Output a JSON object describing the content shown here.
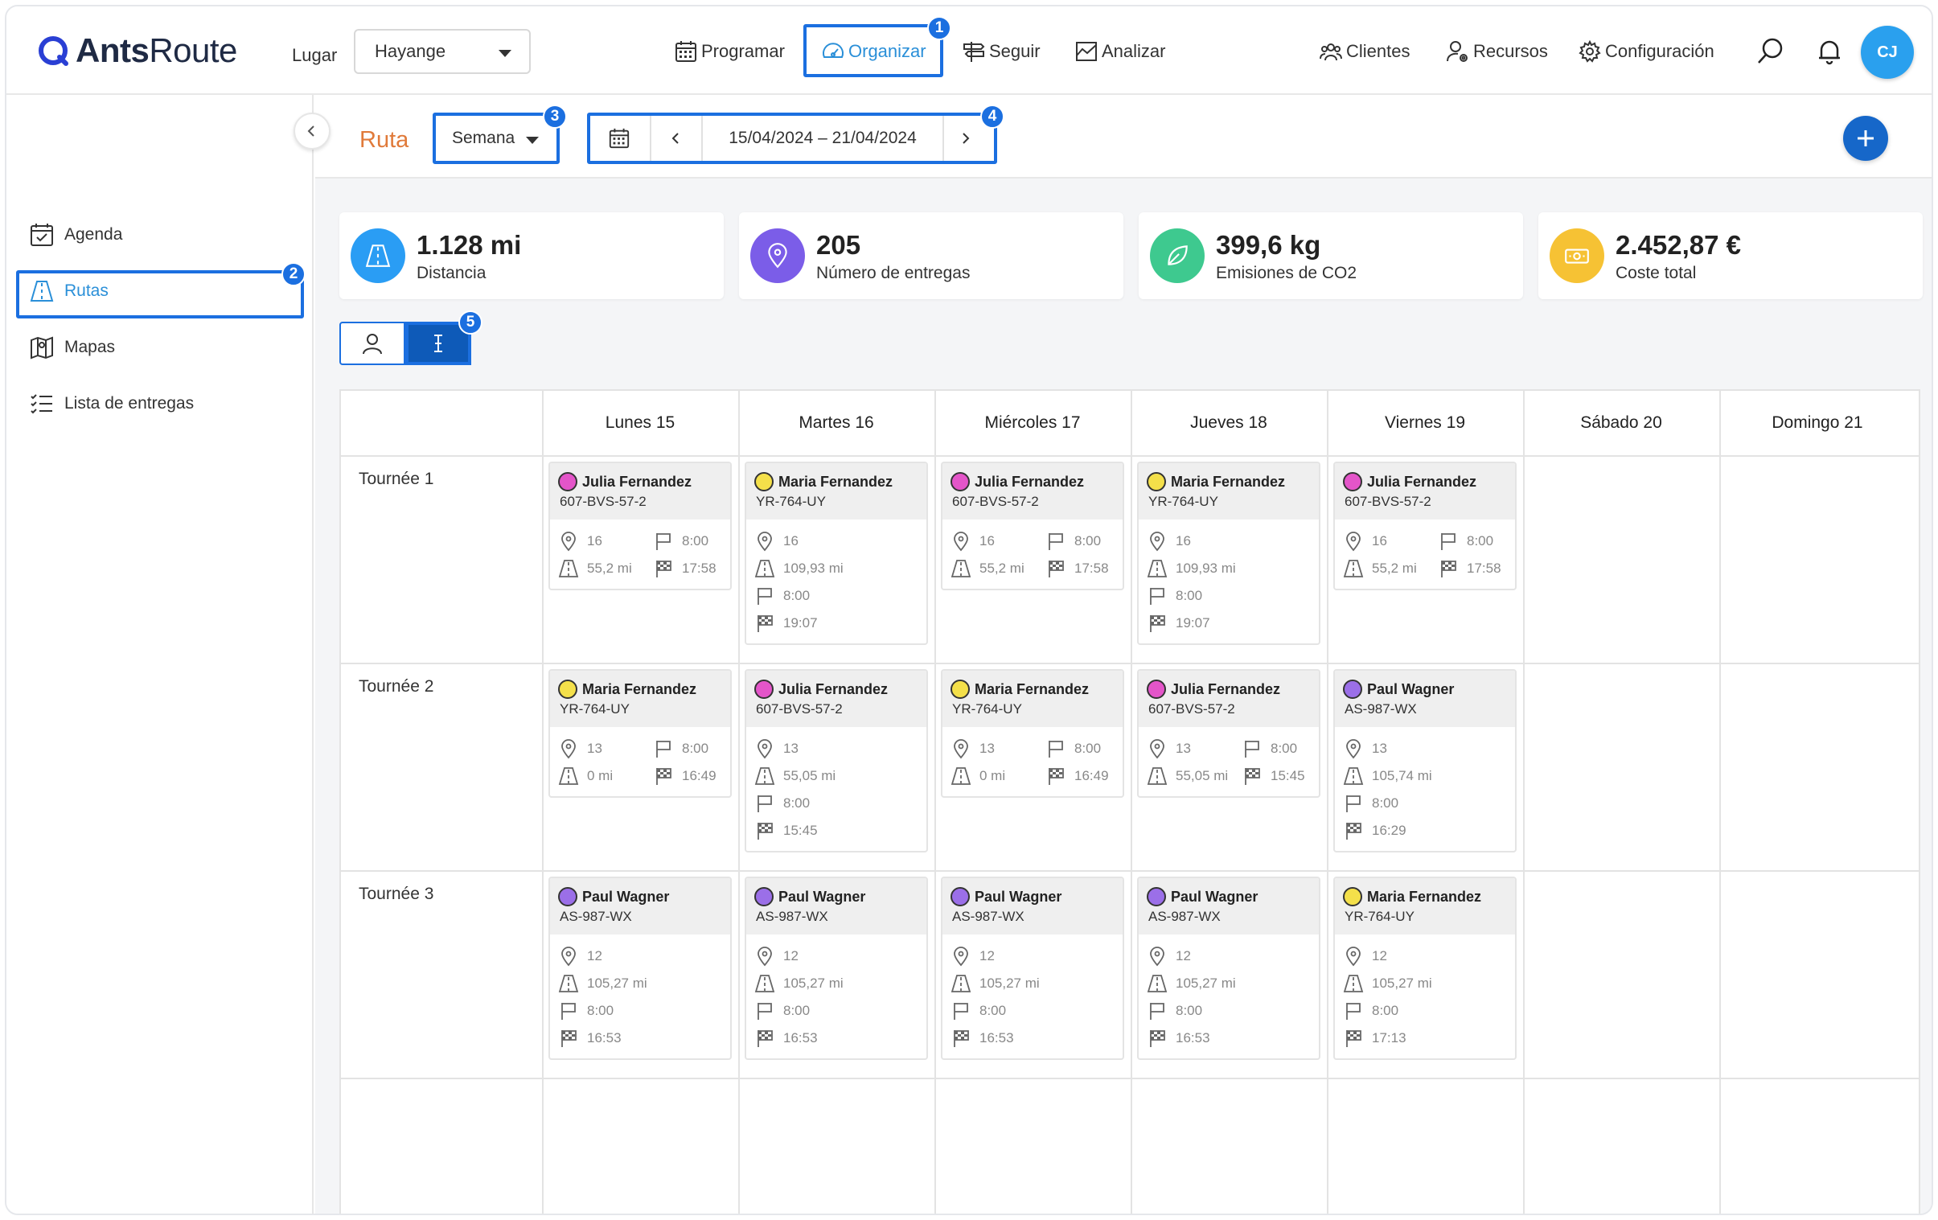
{
  "app": {
    "brand_bold": "Ants",
    "brand_light": "Route",
    "avatar_initials": "CJ"
  },
  "header": {
    "lugar_label": "Lugar",
    "lugar_value": "Hayange",
    "nav": [
      {
        "label": "Programar",
        "icon": "calendar-icon"
      },
      {
        "label": "Organizar",
        "icon": "speedometer-icon",
        "active": true
      },
      {
        "label": "Seguir",
        "icon": "signpost-icon"
      },
      {
        "label": "Analizar",
        "icon": "chart-icon"
      }
    ],
    "right_nav": [
      {
        "label": "Clientes",
        "icon": "people-icon"
      },
      {
        "label": "Recursos",
        "icon": "user-gear-icon"
      },
      {
        "label": "Configuración",
        "icon": "gear-icon"
      }
    ]
  },
  "sidebar": {
    "items": [
      {
        "label": "Agenda",
        "icon": "calendar-check-icon"
      },
      {
        "label": "Rutas",
        "icon": "road-icon",
        "active": true
      },
      {
        "label": "Mapas",
        "icon": "map-icon"
      },
      {
        "label": "Lista de entregas",
        "icon": "checklist-icon"
      }
    ]
  },
  "subheader": {
    "title": "Ruta",
    "period": "Semana",
    "date_range": "15/04/2024 – 21/04/2024"
  },
  "annotations": {
    "b1": "1",
    "b2": "2",
    "b3": "3",
    "b4": "4",
    "b5": "5"
  },
  "stats": [
    {
      "value": "1.128 mi",
      "label": "Distancia",
      "color": "#2a9df4",
      "icon": "road-icon"
    },
    {
      "value": "205",
      "label": "Número de entregas",
      "color": "#7b5de8",
      "icon": "pin-icon"
    },
    {
      "value": "399,6 kg",
      "label": "Emisiones de CO2",
      "color": "#3ec98f",
      "icon": "leaf-icon"
    },
    {
      "value": "2.452,87 €",
      "label": "Coste total",
      "color": "#f6c234",
      "icon": "money-icon"
    }
  ],
  "days": [
    "Lunes 15",
    "Martes 16",
    "Miércoles 17",
    "Jueves 18",
    "Viernes 19",
    "Sábado 20",
    "Domingo 21"
  ],
  "tours": [
    "Tournée 1",
    "Tournée 2",
    "Tournée 3"
  ],
  "colors": {
    "pink": "#e455c9",
    "yellow": "#f4e04a",
    "purple": "#9b6fe8",
    "accent": "#2a8fd8",
    "highlight": "#1b6fe0"
  },
  "cards": [
    [
      {
        "name": "Julia Fernandez",
        "plate": "607-BVS-57-2",
        "dot": "pink",
        "stops": "16",
        "dist": "55,2 mi",
        "start": "8:00",
        "end": "17:58",
        "compact": true
      },
      {
        "name": "Maria Fernandez",
        "plate": "YR-764-UY",
        "dot": "yellow",
        "stops": "16",
        "dist": "109,93 mi",
        "start": "8:00",
        "end": "19:07",
        "compact": false
      },
      {
        "name": "Julia Fernandez",
        "plate": "607-BVS-57-2",
        "dot": "pink",
        "stops": "16",
        "dist": "55,2 mi",
        "start": "8:00",
        "end": "17:58",
        "compact": true
      },
      {
        "name": "Maria Fernandez",
        "plate": "YR-764-UY",
        "dot": "yellow",
        "stops": "16",
        "dist": "109,93 mi",
        "start": "8:00",
        "end": "19:07",
        "compact": false
      },
      {
        "name": "Julia Fernandez",
        "plate": "607-BVS-57-2",
        "dot": "pink",
        "stops": "16",
        "dist": "55,2 mi",
        "start": "8:00",
        "end": "17:58",
        "compact": true
      }
    ],
    [
      {
        "name": "Maria Fernandez",
        "plate": "YR-764-UY",
        "dot": "yellow",
        "stops": "13",
        "dist": "0 mi",
        "start": "8:00",
        "end": "16:49",
        "compact": true
      },
      {
        "name": "Julia Fernandez",
        "plate": "607-BVS-57-2",
        "dot": "pink",
        "stops": "13",
        "dist": "55,05 mi",
        "start": "8:00",
        "end": "15:45",
        "compact": false
      },
      {
        "name": "Maria Fernandez",
        "plate": "YR-764-UY",
        "dot": "yellow",
        "stops": "13",
        "dist": "0 mi",
        "start": "8:00",
        "end": "16:49",
        "compact": true
      },
      {
        "name": "Julia Fernandez",
        "plate": "607-BVS-57-2",
        "dot": "pink",
        "stops": "13",
        "dist": "55,05 mi",
        "start": "8:00",
        "end": "15:45",
        "compact": true
      },
      {
        "name": "Paul Wagner",
        "plate": "AS-987-WX",
        "dot": "purple",
        "stops": "13",
        "dist": "105,74 mi",
        "start": "8:00",
        "end": "16:29",
        "compact": false
      }
    ],
    [
      {
        "name": "Paul Wagner",
        "plate": "AS-987-WX",
        "dot": "purple",
        "stops": "12",
        "dist": "105,27 mi",
        "start": "8:00",
        "end": "16:53",
        "compact": false
      },
      {
        "name": "Paul Wagner",
        "plate": "AS-987-WX",
        "dot": "purple",
        "stops": "12",
        "dist": "105,27 mi",
        "start": "8:00",
        "end": "16:53",
        "compact": false
      },
      {
        "name": "Paul Wagner",
        "plate": "AS-987-WX",
        "dot": "purple",
        "stops": "12",
        "dist": "105,27 mi",
        "start": "8:00",
        "end": "16:53",
        "compact": false
      },
      {
        "name": "Paul Wagner",
        "plate": "AS-987-WX",
        "dot": "purple",
        "stops": "12",
        "dist": "105,27 mi",
        "start": "8:00",
        "end": "16:53",
        "compact": false
      },
      {
        "name": "Maria Fernandez",
        "plate": "YR-764-UY",
        "dot": "yellow",
        "stops": "12",
        "dist": "105,27 mi",
        "start": "8:00",
        "end": "17:13",
        "compact": false
      }
    ]
  ]
}
